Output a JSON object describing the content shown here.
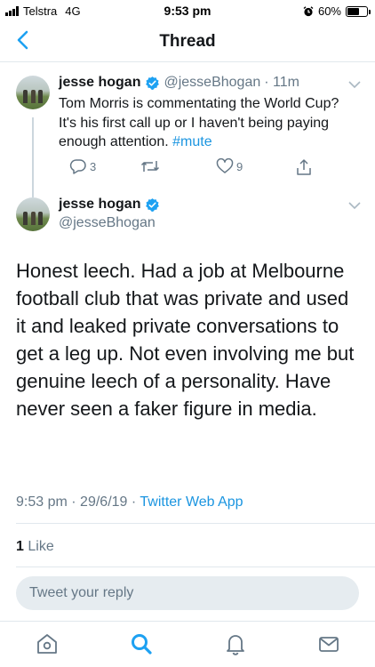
{
  "status_bar": {
    "carrier": "Telstra",
    "network": "4G",
    "time": "9:53 pm",
    "battery": "60%",
    "battery_level": 0.6
  },
  "nav": {
    "title": "Thread",
    "back_icon": "chevron-left-icon"
  },
  "parent_tweet": {
    "name": "jesse hogan",
    "handle": "@jesseBhogan",
    "age": "· 11m",
    "text": "Tom Morris is commentating the World Cup? It's his first call up or I haven't being paying enough attention.",
    "hashtag": "#mute",
    "reply_count": "3",
    "retweet_count": "",
    "like_count": "9"
  },
  "main_tweet": {
    "name": "jesse hogan",
    "handle": "@jesseBhogan",
    "text": "Honest leech. Had a job at Melbourne football club that was private and used it and leaked private conversations to get a leg up. Not even involving me but genuine leech of a personality. Have never seen a faker figure in media.",
    "time": "9:53 pm",
    "date": "29/6/19",
    "source": "Twitter Web App",
    "like_count": "1",
    "like_label": "Like"
  },
  "reply": {
    "placeholder": "Tweet your reply"
  },
  "tab_bar": {
    "items": [
      "home-icon",
      "search-icon",
      "notifications-icon",
      "messages-icon"
    ]
  },
  "colors": {
    "accent": "#1da1f2",
    "link": "#1b95e0",
    "secondary_text": "#657786"
  }
}
